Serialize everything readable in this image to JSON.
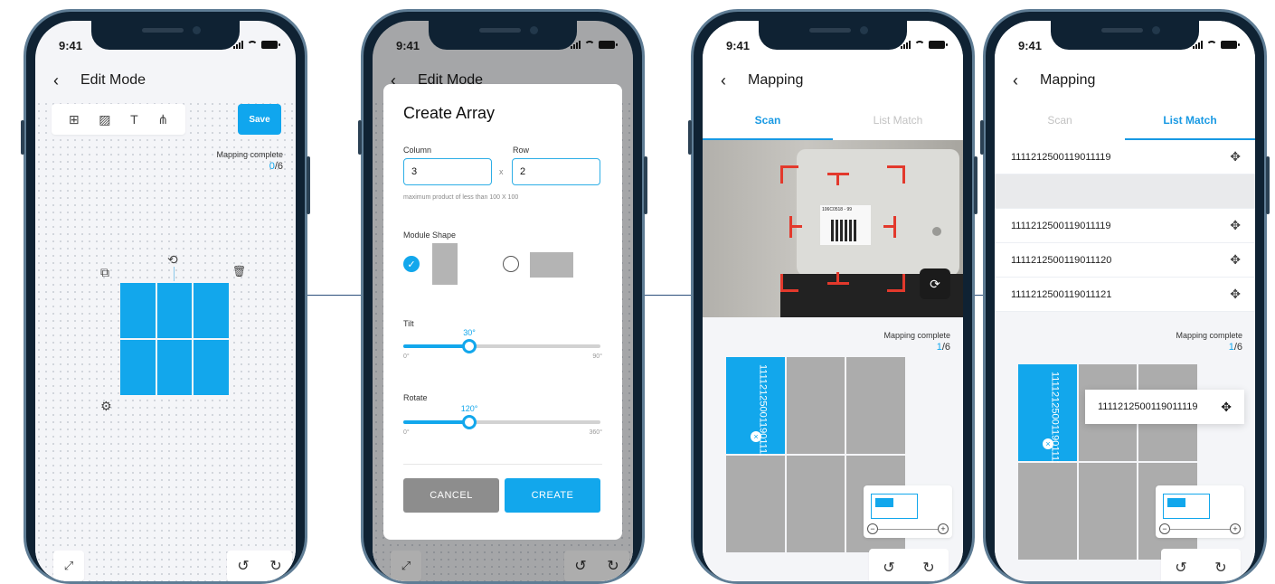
{
  "status": {
    "time": "9:41"
  },
  "screen1": {
    "nav": {
      "back": "‹",
      "title": "Edit Mode"
    },
    "toolbar": {
      "grid_icon": "⊞",
      "image_icon": "▨",
      "text_icon": "T",
      "tree_icon": "⋔"
    },
    "save_label": "Save",
    "mapping": {
      "label": "Mapping complete",
      "done": "0",
      "total": "/6"
    },
    "icons": {
      "copy": "⧉",
      "rotate": "⟲",
      "delete": "🗑",
      "settings": "⚙",
      "expand": "⤢",
      "undo": "↺",
      "redo": "↻"
    }
  },
  "screen2": {
    "nav": {
      "back": "‹",
      "title": "Edit Mode"
    },
    "dialog": {
      "title": "Create Array",
      "column_label": "Column",
      "row_label": "Row",
      "column_value": "3",
      "row_value": "2",
      "times": "x",
      "hint": "maximum product of less than 100 X 100",
      "module_shape_label": "Module Shape",
      "tilt": {
        "label": "Tilt",
        "value": "30°",
        "min": "0°",
        "max": "90°",
        "fraction": 0.333
      },
      "rotate": {
        "label": "Rotate",
        "value": "120°",
        "min": "0°",
        "max": "360°",
        "fraction": 0.333
      },
      "cancel": "CANCEL",
      "create": "CREATE"
    },
    "icons": {
      "expand": "⤢",
      "undo": "↺",
      "redo": "↻"
    }
  },
  "screen3": {
    "nav": {
      "back": "‹",
      "title": "Mapping"
    },
    "tabs": [
      {
        "label": "Scan"
      },
      {
        "label": "List Match"
      }
    ],
    "camera_label_text": "106C0518 - 99",
    "mapping": {
      "label": "Mapping complete",
      "done": "1",
      "total": "/6"
    },
    "active_cell_text": "1111212500119011119",
    "icons": {
      "switch_camera": "⟳",
      "remove": "×",
      "zoom_out": "−",
      "zoom_in": "+",
      "undo": "↺",
      "redo": "↻"
    }
  },
  "screen4": {
    "nav": {
      "back": "‹",
      "title": "Mapping"
    },
    "tabs": [
      {
        "label": "Scan"
      },
      {
        "label": "List Match"
      }
    ],
    "list": [
      "1111212500119011119",
      "",
      "1111212500119011119",
      "1111212500119011120",
      "1111212500119011121"
    ],
    "drag_item": "1111212500119011119",
    "mapping": {
      "label": "Mapping complete",
      "done": "1",
      "total": "/6"
    },
    "active_cell_text": "1111212500119011119",
    "icons": {
      "move": "✥",
      "remove": "×",
      "zoom_out": "−",
      "zoom_in": "+",
      "undo": "↺",
      "redo": "↻"
    }
  },
  "colors": {
    "accent": "#12a7ec",
    "module_grey": "#acacac",
    "cancel_grey": "#8d8d8d",
    "scan_frame": "#e3392c"
  }
}
